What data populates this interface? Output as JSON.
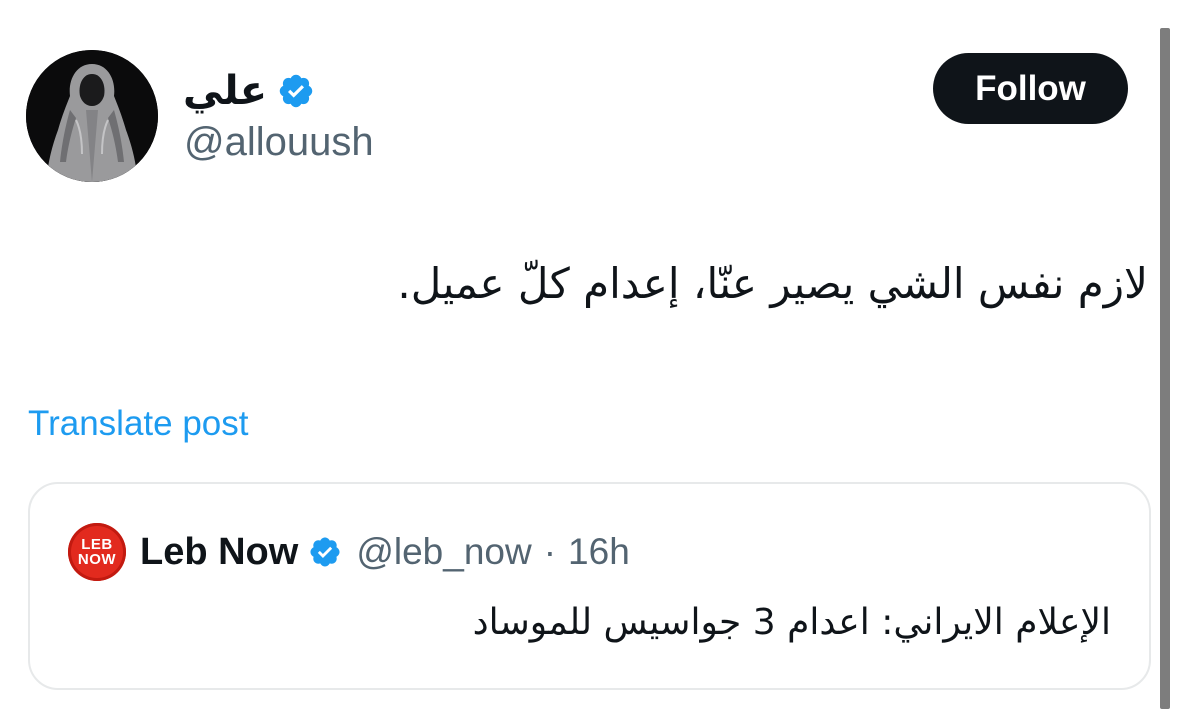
{
  "author": {
    "display_name": "علي",
    "handle": "@allouush",
    "verified": true,
    "avatar_icon": "hooded-figure-avatar"
  },
  "follow_button": {
    "label": "Follow"
  },
  "tweet": {
    "text": "لازم نفس الشي يصير عنّا، إعدام كلّ عميل."
  },
  "translate": {
    "label": "Translate post"
  },
  "quoted_tweet": {
    "avatar_text_top": "LEB",
    "avatar_text_bottom": "NOW",
    "display_name": "Leb Now",
    "verified": true,
    "handle": "@leb_now",
    "separator": "·",
    "time": "16h",
    "text": "الإعلام الايراني: اعدام 3 جواسيس للموساد"
  },
  "colors": {
    "text_primary": "#0f1419",
    "text_secondary": "#536471",
    "link": "#1d9bf0",
    "verified_badge": "#1d9bf0",
    "follow_bg": "#0f1419",
    "leb_now_red": "#e22a1e"
  }
}
